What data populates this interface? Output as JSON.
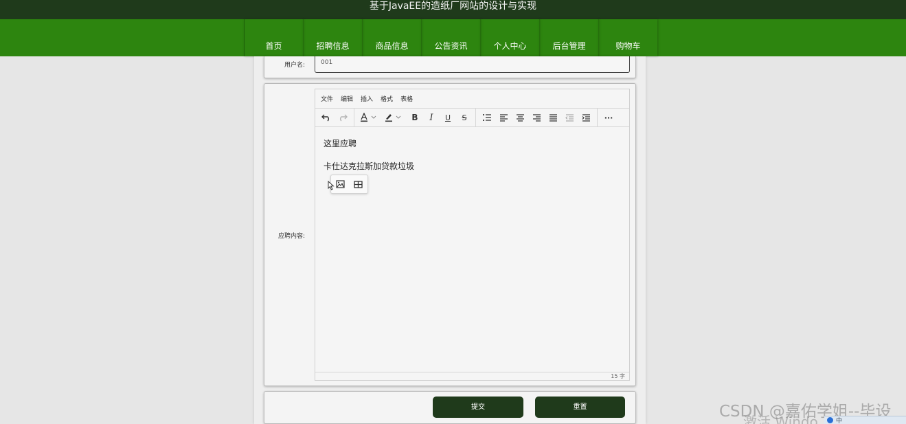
{
  "header": {
    "title": "基于JavaEE的造纸厂网站的设计与实现"
  },
  "nav": {
    "items": [
      {
        "label": "首页"
      },
      {
        "label": "招聘信息"
      },
      {
        "label": "商品信息"
      },
      {
        "label": "公告资讯"
      },
      {
        "label": "个人中心"
      },
      {
        "label": "后台管理"
      },
      {
        "label": "购物车"
      }
    ]
  },
  "form": {
    "username_label": "用户名:",
    "username_value": "001",
    "content_label": "应聘内容:",
    "submit_label": "提交",
    "reset_label": "重置"
  },
  "editor": {
    "menu": [
      "文件",
      "编辑",
      "插入",
      "格式",
      "表格"
    ],
    "paragraphs": [
      "这里应聘",
      "卡仕达克拉斯加贷款垃圾"
    ],
    "word_count": "15 字",
    "toolbar_icons": [
      "undo-icon",
      "redo-icon",
      "font-color-icon",
      "highlight-icon",
      "bold-icon",
      "italic-icon",
      "underline-icon",
      "strikethrough-icon",
      "line-height-icon",
      "align-left-icon",
      "align-center-icon",
      "align-right-icon",
      "justify-icon",
      "outdent-icon",
      "indent-icon",
      "more-icon"
    ],
    "toolbar_glyphs": {
      "bold": "B",
      "italic": "I",
      "underline": "U",
      "strike": "S",
      "more": "···"
    }
  },
  "watermark": {
    "csdn": "CSDN @嘉佑学姐--毕设",
    "activate": "激活 Windo"
  },
  "tray": {
    "ime": "中"
  },
  "colors": {
    "topbar": "#1f3a1b",
    "navbar": "#2d850f",
    "button": "#1f3a1b"
  }
}
